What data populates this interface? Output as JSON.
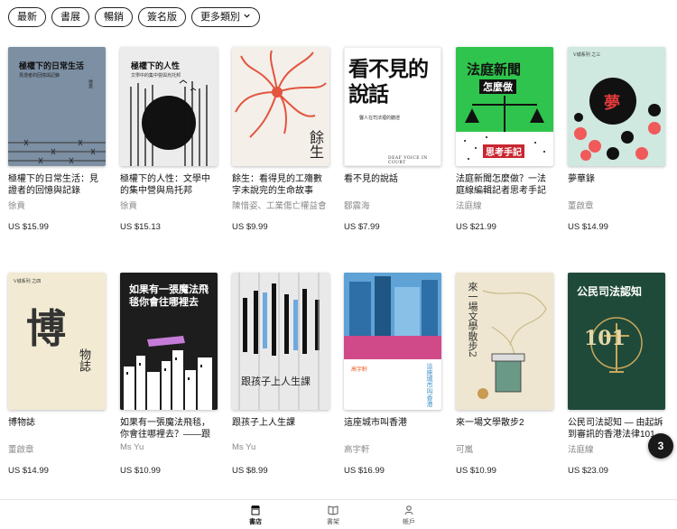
{
  "filters": [
    {
      "label": "最新"
    },
    {
      "label": "書展"
    },
    {
      "label": "暢銷"
    },
    {
      "label": "簽名版"
    },
    {
      "label": "更多類別"
    }
  ],
  "books_row1": [
    {
      "title": "極權下的日常生活：見證者的回憶與記錄",
      "author": "徐賁",
      "price": "US $15.99",
      "cover_title": "極權下的日常生活",
      "cover_sub": "見證者的回憶與記錄",
      "cover_author": "徐賁",
      "cover_color": "#7c8fa3"
    },
    {
      "title": "極權下的人性：文學中的集中營與烏托邦",
      "author": "徐賁",
      "price": "US $15.13",
      "cover_title": "極權下的人性",
      "cover_sub": "文學中的集中營與烏托邦",
      "cover_author": "徐賁",
      "cover_color": "#ececec"
    },
    {
      "title": "餘生：看得見的工殤數字未說完的生命故事",
      "author": "陳惜姿、工業傷亡權益會",
      "price": "US $9.99",
      "cover_title": "餘生",
      "cover_color": "#f4efe9"
    },
    {
      "title": "看不見的說話",
      "author": "鄒震海",
      "price": "US $7.99",
      "cover_title": "看不見的說話",
      "cover_sub": "聾人在司法裡的聽證",
      "cover_en": "DEAF VOICE IN COURT",
      "cover_color": "#ffffff"
    },
    {
      "title": "法庭新聞怎麼做？一法庭線編輯記者思考手記",
      "author": "法庭線",
      "price": "US $21.99",
      "cover_title": "法庭新聞",
      "cover_sub": "怎麼做",
      "cover_foot": "思考手記",
      "cover_color": "#2fc44d"
    },
    {
      "title": "夢華錄",
      "author": "董啟章",
      "price": "US $14.99",
      "cover_title": "夢",
      "cover_series": "V城系列 之三",
      "cover_color": "#cfe8e0"
    }
  ],
  "books_row2": [
    {
      "title": "博物誌",
      "author": "董啟章",
      "price": "US $14.99",
      "cover_title": "博",
      "cover_title2": "物誌",
      "cover_series": "V城系列 之四",
      "cover_color": "#f2ead3"
    },
    {
      "title": "如果有一張魔法飛毯，你會往哪裡去？——跟孩...",
      "author": "Ms Yu",
      "price": "US $10.99",
      "cover_title": "如果有一張魔法飛毯你會往哪裡去",
      "cover_color": "#1d1d1d"
    },
    {
      "title": "跟孩子上人生課",
      "author": "Ms Yu",
      "price": "US $8.99",
      "cover_title": "跟孩子上人生課",
      "cover_color": "#e9e9ea"
    },
    {
      "title": "這座城市叫香港",
      "author": "高宇軒",
      "price": "US $16.99",
      "cover_title": "這座城市叫香港",
      "cover_author": "高宇軒",
      "cover_color": "#3b8ec9"
    },
    {
      "title": "來一場文學散步2",
      "author": "可嵐",
      "price": "US $10.99",
      "cover_title": "來一場文學散步2",
      "cover_color": "#eee6d0"
    },
    {
      "title": "公民司法認知 — 由起訴到審訊的香港法律101",
      "author": "法庭線",
      "price": "US $23.09",
      "cover_title": "公民司法認知",
      "cover_num": "101",
      "cover_color": "#1f4a39"
    }
  ],
  "fab": {
    "label": "3"
  },
  "tabbar": [
    {
      "label": "書店",
      "icon": "store-icon",
      "active": true
    },
    {
      "label": "書架",
      "icon": "bookshelf-icon",
      "active": false
    },
    {
      "label": "帳戶",
      "icon": "account-icon",
      "active": false
    }
  ],
  "colors": {
    "accent": "#111111",
    "muted": "#888888"
  }
}
